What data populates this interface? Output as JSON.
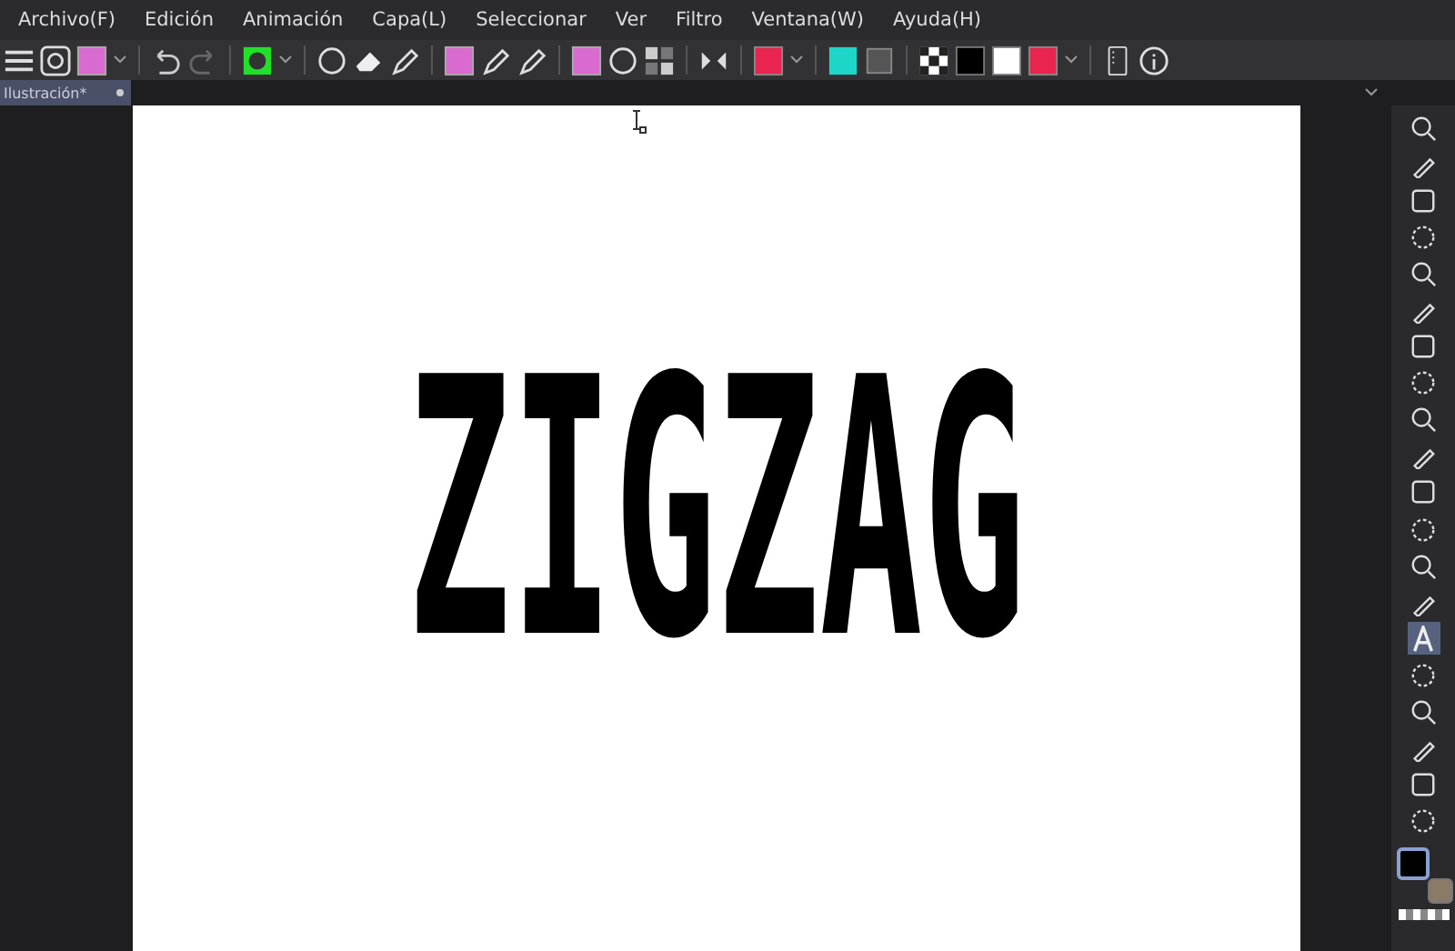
{
  "menu": [
    "Archivo(F)",
    "Edición",
    "Animación",
    "Capa(L)",
    "Seleccionar",
    "Ver",
    "Filtro",
    "Ventana(W)",
    "Ayuda(H)"
  ],
  "document_tab": {
    "title": "Ilustración*",
    "modified": true
  },
  "canvas": {
    "text": "ZIGZAG"
  },
  "tools": [
    {
      "selected": false
    },
    {
      "selected": false
    },
    {
      "selected": false
    },
    {
      "selected": false
    },
    {
      "selected": false
    },
    {
      "selected": false
    },
    {
      "selected": false
    },
    {
      "selected": false
    },
    {
      "selected": false
    },
    {
      "selected": false
    },
    {
      "selected": false
    },
    {
      "selected": false
    },
    {
      "selected": false
    },
    {
      "selected": false
    },
    {
      "selected": true
    },
    {
      "selected": false
    },
    {
      "selected": false
    },
    {
      "selected": false
    },
    {
      "selected": false
    },
    {
      "selected": false
    }
  ],
  "color_swatches": [
    {
      "kind": "main",
      "color": "#000000"
    },
    {
      "kind": "sub",
      "color": "#8a7a68"
    }
  ]
}
